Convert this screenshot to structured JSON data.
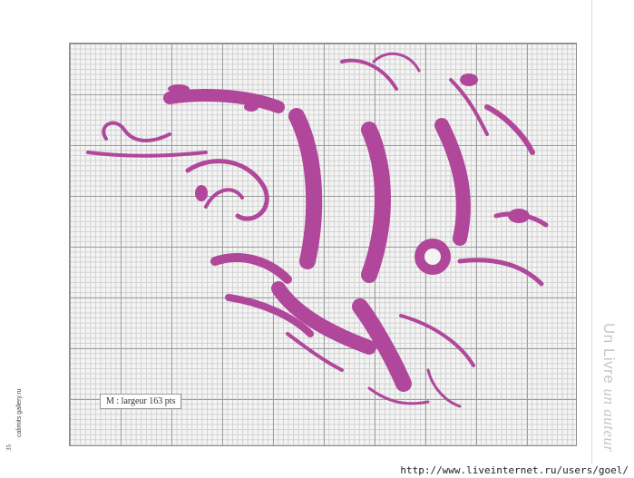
{
  "caption": "M : largeur 163 pts",
  "side_title": {
    "plain": "Un Livre ",
    "italic": "un auteur"
  },
  "spine_text": "calimits gallery.ru",
  "page_number": "35",
  "footer_url": "http://www.liveinternet.ru/users/goel/",
  "colors": {
    "motif": "#b0479b",
    "grid_major": "#9e9e9e",
    "grid_minor": "#d0d0d0",
    "background": "#f4f4f4"
  },
  "pattern": {
    "subject": "cross-stitch monogram letter M with floral ornaments"
  }
}
